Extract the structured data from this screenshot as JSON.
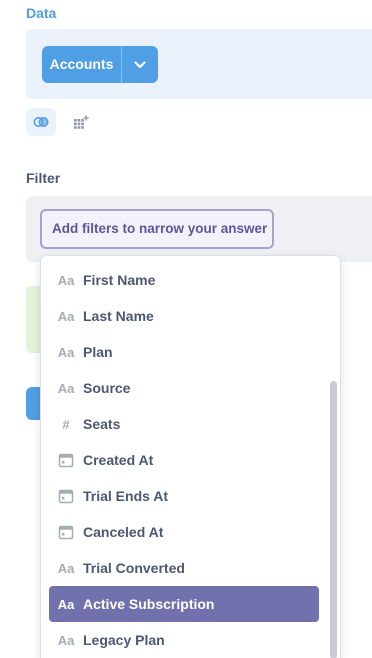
{
  "data_section": {
    "title": "Data",
    "source_button": "Accounts"
  },
  "filter_section": {
    "title": "Filter",
    "placeholder_button": "Add filters to narrow your answer"
  },
  "dropdown": {
    "items": [
      {
        "label": "First Name",
        "icon": "text-type-icon",
        "glyph": "Aa"
      },
      {
        "label": "Last Name",
        "icon": "text-type-icon",
        "glyph": "Aa"
      },
      {
        "label": "Plan",
        "icon": "text-type-icon",
        "glyph": "Aa"
      },
      {
        "label": "Source",
        "icon": "text-type-icon",
        "glyph": "Aa"
      },
      {
        "label": "Seats",
        "icon": "number-type-icon",
        "glyph": "#"
      },
      {
        "label": "Created At",
        "icon": "calendar-icon",
        "glyph": ""
      },
      {
        "label": "Trial Ends At",
        "icon": "calendar-icon",
        "glyph": ""
      },
      {
        "label": "Canceled At",
        "icon": "calendar-icon",
        "glyph": ""
      },
      {
        "label": "Trial Converted",
        "icon": "text-type-icon",
        "glyph": "Aa"
      },
      {
        "label": "Active Subscription",
        "icon": "text-type-icon",
        "glyph": "Aa"
      },
      {
        "label": "Legacy Plan",
        "icon": "text-type-icon",
        "glyph": "Aa"
      }
    ],
    "selected_label": "Active Subscription"
  },
  "colors": {
    "brand": "#509ee3",
    "filter_accent": "#7172ad",
    "text": "#4c5773",
    "icon_muted": "#a6acb5"
  }
}
